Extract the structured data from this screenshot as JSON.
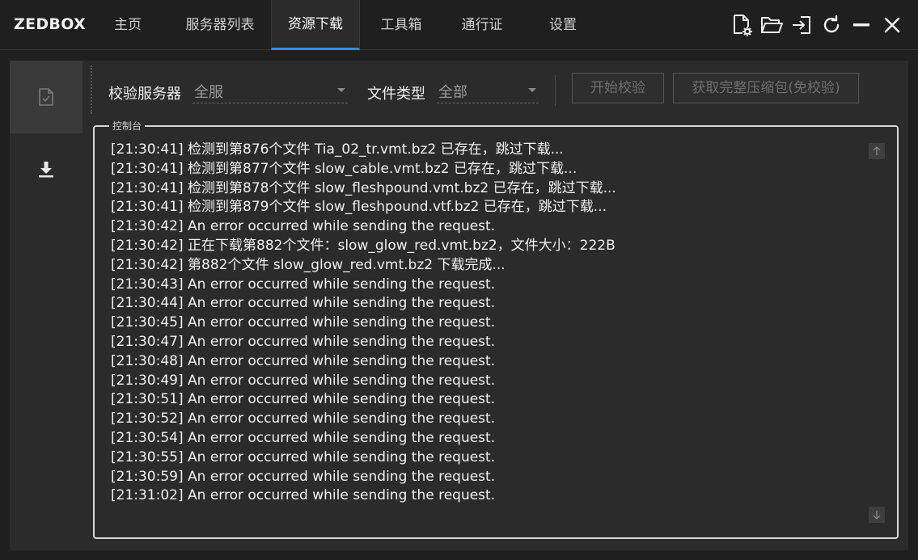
{
  "app": {
    "brand": "ZEDBOX"
  },
  "nav": {
    "items": [
      {
        "label": "主页"
      },
      {
        "label": "服务器列表"
      },
      {
        "label": "资源下载",
        "active": true
      },
      {
        "label": "工具箱"
      },
      {
        "label": "通行证"
      },
      {
        "label": "设置"
      }
    ]
  },
  "window_icons": [
    "file-settings-icon",
    "folder-open-icon",
    "sign-in-icon",
    "refresh-icon",
    "minimize-icon",
    "close-icon"
  ],
  "sidebar": {
    "items": [
      {
        "icon": "file-check-icon",
        "active": true
      },
      {
        "icon": "download-icon",
        "active": false
      }
    ]
  },
  "toolbar": {
    "server_label": "校验服务器",
    "server_value": "全服",
    "filetype_label": "文件类型",
    "filetype_value": "全部",
    "start_verify_label": "开始校验",
    "get_package_label": "获取完整压缩包(免校验)"
  },
  "console": {
    "title": "控制台",
    "lines": [
      "[21:30:41] 检测到第876个文件 Tia_02_tr.vmt.bz2 已存在，跳过下载...",
      "[21:30:41] 检测到第877个文件 slow_cable.vmt.bz2 已存在，跳过下载...",
      "[21:30:41] 检测到第878个文件 slow_fleshpound.vmt.bz2 已存在，跳过下载...",
      "[21:30:41] 检测到第879个文件 slow_fleshpound.vtf.bz2 已存在，跳过下载...",
      "[21:30:42] An error occurred while sending the request.",
      "[21:30:42] 正在下载第882个文件：slow_glow_red.vmt.bz2，文件大小：222B",
      "[21:30:42] 第882个文件 slow_glow_red.vmt.bz2 下载完成...",
      "[21:30:43] An error occurred while sending the request.",
      "[21:30:44] An error occurred while sending the request.",
      "[21:30:45] An error occurred while sending the request.",
      "[21:30:47] An error occurred while sending the request.",
      "[21:30:48] An error occurred while sending the request.",
      "[21:30:49] An error occurred while sending the request.",
      "[21:30:51] An error occurred while sending the request.",
      "[21:30:52] An error occurred while sending the request.",
      "[21:30:54] An error occurred while sending the request.",
      "[21:30:55] An error occurred while sending the request.",
      "[21:30:59] An error occurred while sending the request.",
      "[21:31:02] An error occurred while sending the request."
    ]
  },
  "colors": {
    "background": "#1f1f1f",
    "panel": "#2b2b2b",
    "accent": "#2d8cf0",
    "text": "#f2f2f2",
    "muted": "#9a9a9a"
  }
}
